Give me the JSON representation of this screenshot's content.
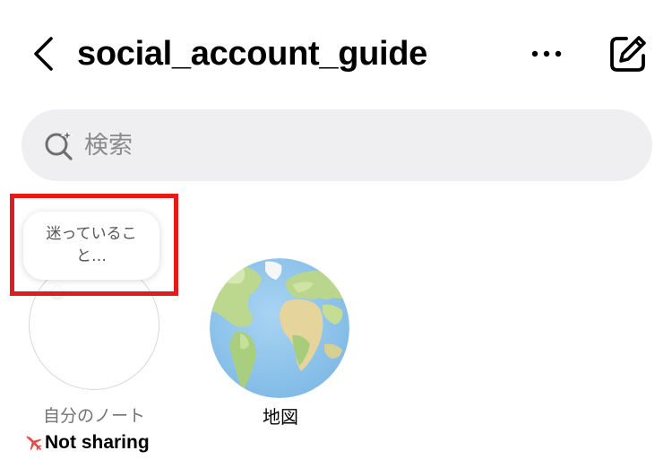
{
  "header": {
    "title": "social_account_guide",
    "back_icon": "chevron-left-icon",
    "more_icon": "more-horizontal-icon",
    "compose_icon": "edit-icon"
  },
  "search": {
    "placeholder": "検索",
    "value": "",
    "icon": "search-sparkle-icon"
  },
  "notes": {
    "bubble_text": "迷っていること…",
    "label": "自分のノート",
    "status": "Not sharing",
    "status_icon": "airplane-icon",
    "highlight_color": "#e21b1b"
  },
  "map": {
    "label": "地図",
    "icon": "globe-icon"
  }
}
